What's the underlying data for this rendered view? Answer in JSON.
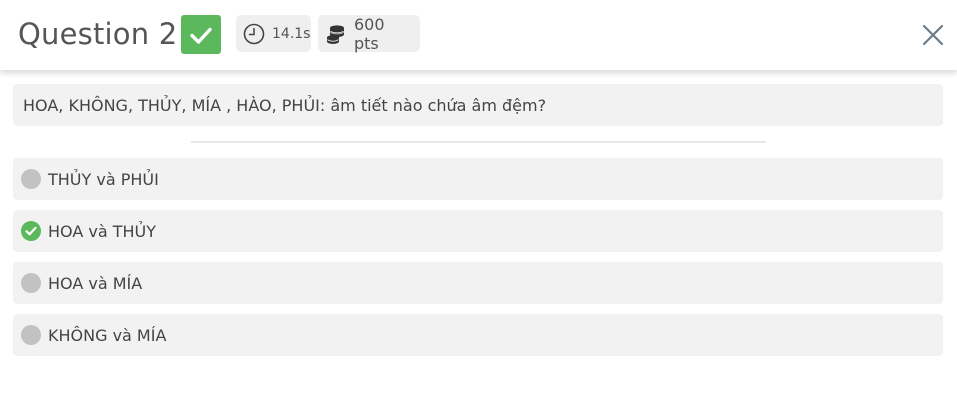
{
  "header": {
    "title": "Question 2",
    "status_icon": "check-icon",
    "time": "14.1s",
    "time_icon": "clock-icon",
    "points": "600 pts",
    "points_icon": "coins-icon",
    "close_icon": "close-icon"
  },
  "question": {
    "text": "HOA, KHÔNG, THỦY, MÍA , HÀO, PHỦI: âm tiết nào chứa âm đệm?"
  },
  "options": [
    {
      "label": "THỦY và PHỦI",
      "correct": false
    },
    {
      "label": "HOA và THỦY",
      "correct": true
    },
    {
      "label": "HOA và MÍA",
      "correct": false
    },
    {
      "label": "KHÔNG và MÍA",
      "correct": false
    }
  ],
  "colors": {
    "correct": "#5cb85c",
    "neutral_marker": "#c2c2c2",
    "card_bg": "#f2f2f2",
    "close_icon": "#6a7d8a"
  }
}
